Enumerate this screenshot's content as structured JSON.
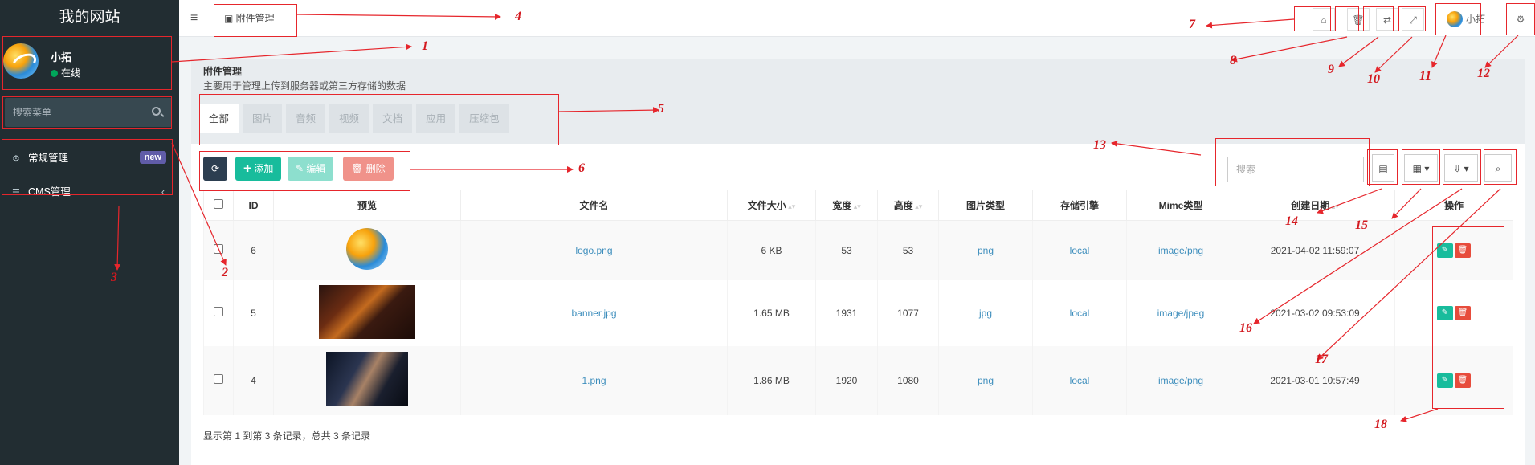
{
  "sidebar": {
    "brand": "我的网站",
    "user": {
      "name": "小拓",
      "status": "在线"
    },
    "search_placeholder": "搜索菜单",
    "menu": [
      {
        "icon": "cogs-icon",
        "label": "常规管理",
        "badge": "new"
      },
      {
        "icon": "list-icon",
        "label": "CMS管理",
        "chevron": "‹"
      }
    ]
  },
  "topbar": {
    "menu_toggle": "≡",
    "active_tab": "附件管理",
    "buttons": [
      "home-icon",
      "trash-icon",
      "translate-icon",
      "fullscreen-icon"
    ],
    "user_name": "小拓",
    "settings_icon": "cogs-icon"
  },
  "page": {
    "title": "附件管理",
    "description": "主要用于管理上传到服务器或第三方存储的数据",
    "filter_tabs": [
      "全部",
      "图片",
      "音频",
      "视频",
      "文档",
      "应用",
      "压缩包"
    ],
    "actions": {
      "refresh": "⟳",
      "add": "添加",
      "edit": "编辑",
      "delete": "删除"
    },
    "search_placeholder": "搜索",
    "footer": "显示第 1 到第 3 条记录，总共 3 条记录"
  },
  "table": {
    "columns": [
      "ID",
      "预览",
      "文件名",
      "文件大小",
      "宽度",
      "高度",
      "图片类型",
      "存储引擎",
      "Mime类型",
      "创建日期",
      "操作"
    ],
    "rows": [
      {
        "id": "6",
        "filename": "logo.png",
        "size": "6 KB",
        "width": "53",
        "height": "53",
        "imagetype": "png",
        "storage": "local",
        "mimetype": "image/png",
        "created": "2021-04-02 11:59:07"
      },
      {
        "id": "5",
        "filename": "banner.jpg",
        "size": "1.65 MB",
        "width": "1931",
        "height": "1077",
        "imagetype": "jpg",
        "storage": "local",
        "mimetype": "image/jpeg",
        "created": "2021-03-02 09:53:09"
      },
      {
        "id": "4",
        "filename": "1.png",
        "size": "1.86 MB",
        "width": "1920",
        "height": "1080",
        "imagetype": "png",
        "storage": "local",
        "mimetype": "image/png",
        "created": "2021-03-01 10:57:49"
      }
    ]
  },
  "annotations": [
    "1",
    "2",
    "3",
    "4",
    "5",
    "6",
    "7",
    "8",
    "9",
    "10",
    "11",
    "12",
    "13",
    "14",
    "15",
    "16",
    "17",
    "18"
  ],
  "colors": {
    "sidebar_bg": "#222d32",
    "add_btn": "#18bc9c",
    "delete_btn": "#e74c3c",
    "annotation": "#e6262c",
    "link": "#3c8dbc",
    "badge": "#605ca8"
  }
}
